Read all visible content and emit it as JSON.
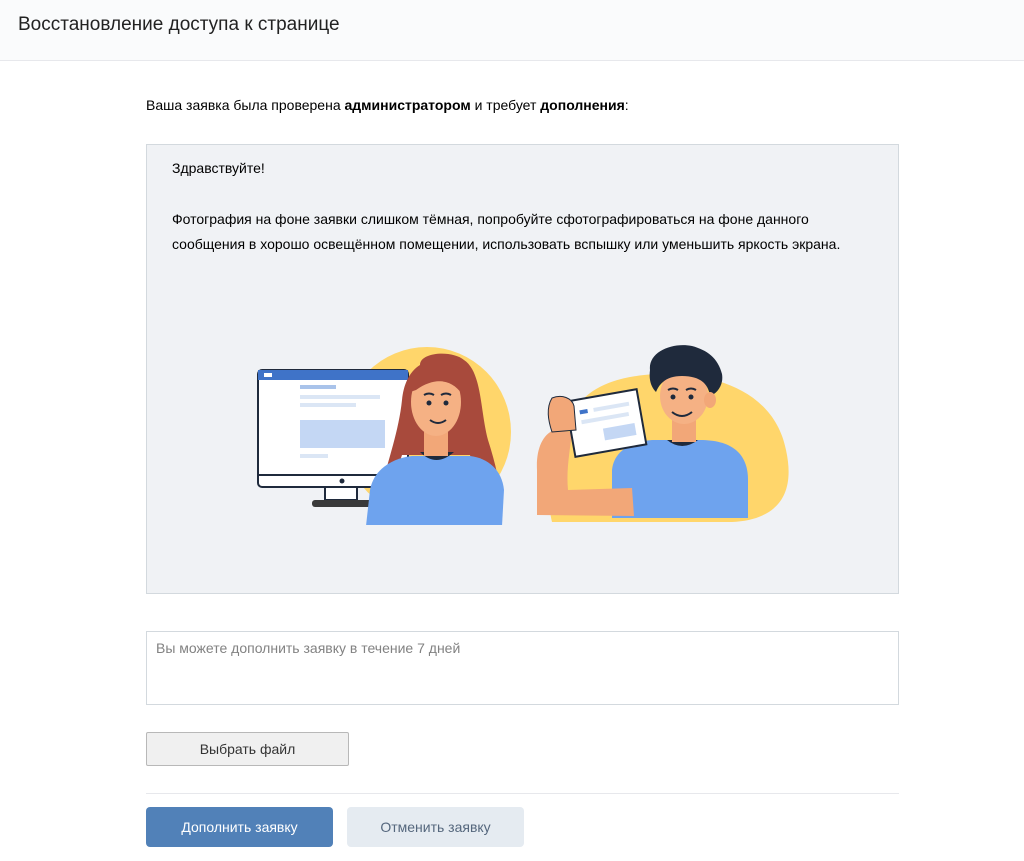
{
  "header": {
    "title": "Восстановление доступа к странице"
  },
  "intro": {
    "part1": "Ваша заявка была проверена ",
    "bold1": "администратором",
    "part2": " и требует ",
    "bold2": "дополнения",
    "part3": ":"
  },
  "message": {
    "greeting": "Здравствуйте!",
    "body": "Фотография на фоне заявки слишком тёмная, попробуйте сфотографироваться на фоне данного сообщения в хорошо освещённом помещении, использовать вспышку или уменьшить яркость экрана.",
    "illustration": "person-at-monitor-and-person-holding-photo-illustration"
  },
  "form": {
    "comment_value": "",
    "comment_placeholder": "Вы можете дополнить заявку в течение 7 дней",
    "file_button_label": "Выбрать файл",
    "submit_label": "Дополнить заявку",
    "cancel_label": "Отменить заявку"
  },
  "colors": {
    "accent": "#5181b8",
    "secondary_button": "#e5ebf1",
    "message_background": "#f0f2f5",
    "border": "#d3d9de",
    "illustration_yellow": "#ffd66b",
    "illustration_blue": "#77aaf7"
  }
}
